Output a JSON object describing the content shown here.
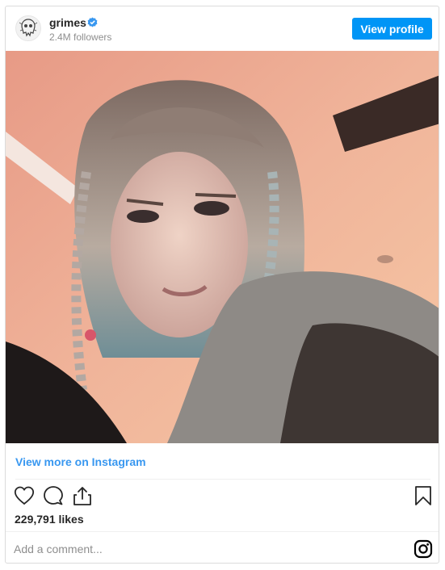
{
  "header": {
    "username": "grimes",
    "followers": "2.4M followers",
    "view_profile_label": "View profile",
    "verified_icon": "verified-badge-icon"
  },
  "post": {
    "view_more_label": "View more on Instagram",
    "likes": "229,791 likes"
  },
  "actions": {
    "like_icon": "heart-icon",
    "comment_icon": "comment-icon",
    "share_icon": "share-icon",
    "save_icon": "bookmark-icon"
  },
  "comment": {
    "placeholder": "Add a comment..."
  },
  "colors": {
    "accent": "#0095f6",
    "link": "#3897f0",
    "muted": "#8e8e8e"
  }
}
